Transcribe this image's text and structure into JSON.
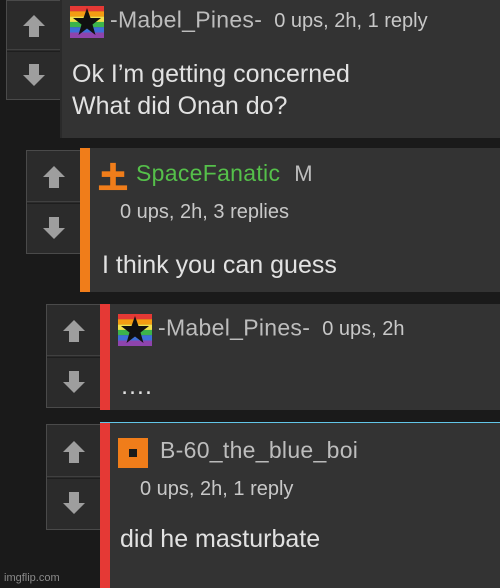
{
  "colors": {
    "orange": "#f07d1a",
    "red": "#e53935",
    "green": "#55c04a",
    "cyan": "#62c6e8"
  },
  "comments": [
    {
      "user": "-Mabel_Pines-",
      "stats": "0 ups, 2h, 1 reply",
      "lines": [
        "Ok I’m getting concerned",
        "What did Onan do?"
      ],
      "avatar": "rainbow-star-flag-icon"
    },
    {
      "user": "SpaceFanatic",
      "mod": "M",
      "stats": "0 ups, 2h, 3 replies",
      "lines": [
        "I think you can guess"
      ],
      "avatar": "orange-cross-icon"
    },
    {
      "user": "-Mabel_Pines-",
      "stats": "0 ups, 2h",
      "lines": [
        "…."
      ],
      "avatar": "rainbow-star-flag-icon"
    },
    {
      "user": "B-60_the_blue_boi",
      "stats": "0 ups, 2h, 1 reply",
      "lines": [
        "did he masturbate"
      ],
      "avatar": "orange-square-icon"
    }
  ],
  "watermark": "imgflip.com"
}
